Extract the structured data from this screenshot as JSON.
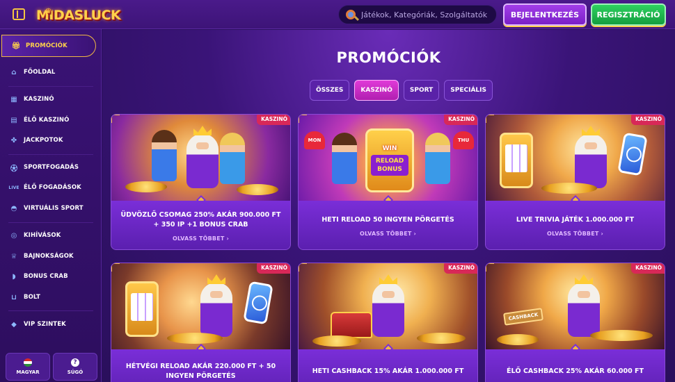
{
  "header": {
    "logo_text": "MIDASLUCK",
    "search_placeholder": "Játékok, Kategóriák, Szolgáltatók",
    "login_label": "BEJELENTKEZÉS",
    "register_label": "REGISZTRÁCIÓ"
  },
  "sidebar": {
    "items": [
      {
        "label": "PROMÓCIÓK",
        "icon": "gift-icon"
      },
      {
        "label": "FŐOLDAL",
        "icon": "home-icon"
      },
      {
        "label": "KASZINÓ",
        "icon": "slot-machine-icon"
      },
      {
        "label": "ÉLŐ KASZINÓ",
        "icon": "cards-icon"
      },
      {
        "label": "JACKPOTOK",
        "icon": "clover-icon"
      },
      {
        "label": "SPORTFOGADÁS",
        "icon": "ball-icon"
      },
      {
        "label": "ÉLŐ FOGADÁSOK",
        "icon": "live-icon"
      },
      {
        "label": "VIRTUÁLIS SPORT",
        "icon": "gamepad-icon"
      },
      {
        "label": "KIHÍVÁSOK",
        "icon": "target-icon"
      },
      {
        "label": "BAJNOKSÁGOK",
        "icon": "trophy-icon"
      },
      {
        "label": "BONUS CRAB",
        "icon": "crab-claw-icon"
      },
      {
        "label": "BOLT",
        "icon": "basket-icon"
      },
      {
        "label": "VIP SZINTEK",
        "icon": "diamond-icon"
      }
    ],
    "language_label": "MAGYAR",
    "help_label": "SÚGÓ"
  },
  "main": {
    "title": "PROMÓCIÓK",
    "filters": [
      "ÖSSZES",
      "KASZINÓ",
      "SPORT",
      "SPECIÁLIS"
    ],
    "active_filter": "KASZINÓ",
    "cards": [
      {
        "badge": "KASZINÓ",
        "title": "ÜDVÖZLŐ CSOMAG 250% AKÁR 900.000 FT + 350 IP +1 BONUS CRAB",
        "link": "OLVASS TÖBBET ›"
      },
      {
        "badge": "KASZINÓ",
        "title": "HETI RELOAD 50 INGYEN PÖRGETÉS",
        "link": "OLVASS TÖBBET ›",
        "art": {
          "sign_top": "WIN",
          "sign_main": "RELOAD BONUS",
          "heart_left": "MON",
          "heart_right": "THU"
        }
      },
      {
        "badge": "KASZINÓ",
        "title": "LIVE TRIVIA JÁTÉK 1.000.000 FT",
        "link": "OLVASS TÖBBET ›"
      },
      {
        "badge": "KASZINÓ",
        "title": "HÉTVÉGI RELOAD AKÁR 220.000 FT + 50 INGYEN PÖRGETÉS",
        "link": ""
      },
      {
        "badge": "KASZINÓ",
        "title": "HETI CASHBACK 15% AKÁR 1.000.000 FT",
        "link": ""
      },
      {
        "badge": "KASZINÓ",
        "title": "ÉLŐ CASHBACK 25% AKÁR 60.000 FT",
        "link": "",
        "art": {
          "sign": "CASHBACK"
        }
      }
    ]
  },
  "colors": {
    "accent_gold": "#f0b844",
    "active_filter": "#e03ad8",
    "badge": "#d82858",
    "register_green": "#2ed060",
    "login_purple": "#a23ee8"
  }
}
